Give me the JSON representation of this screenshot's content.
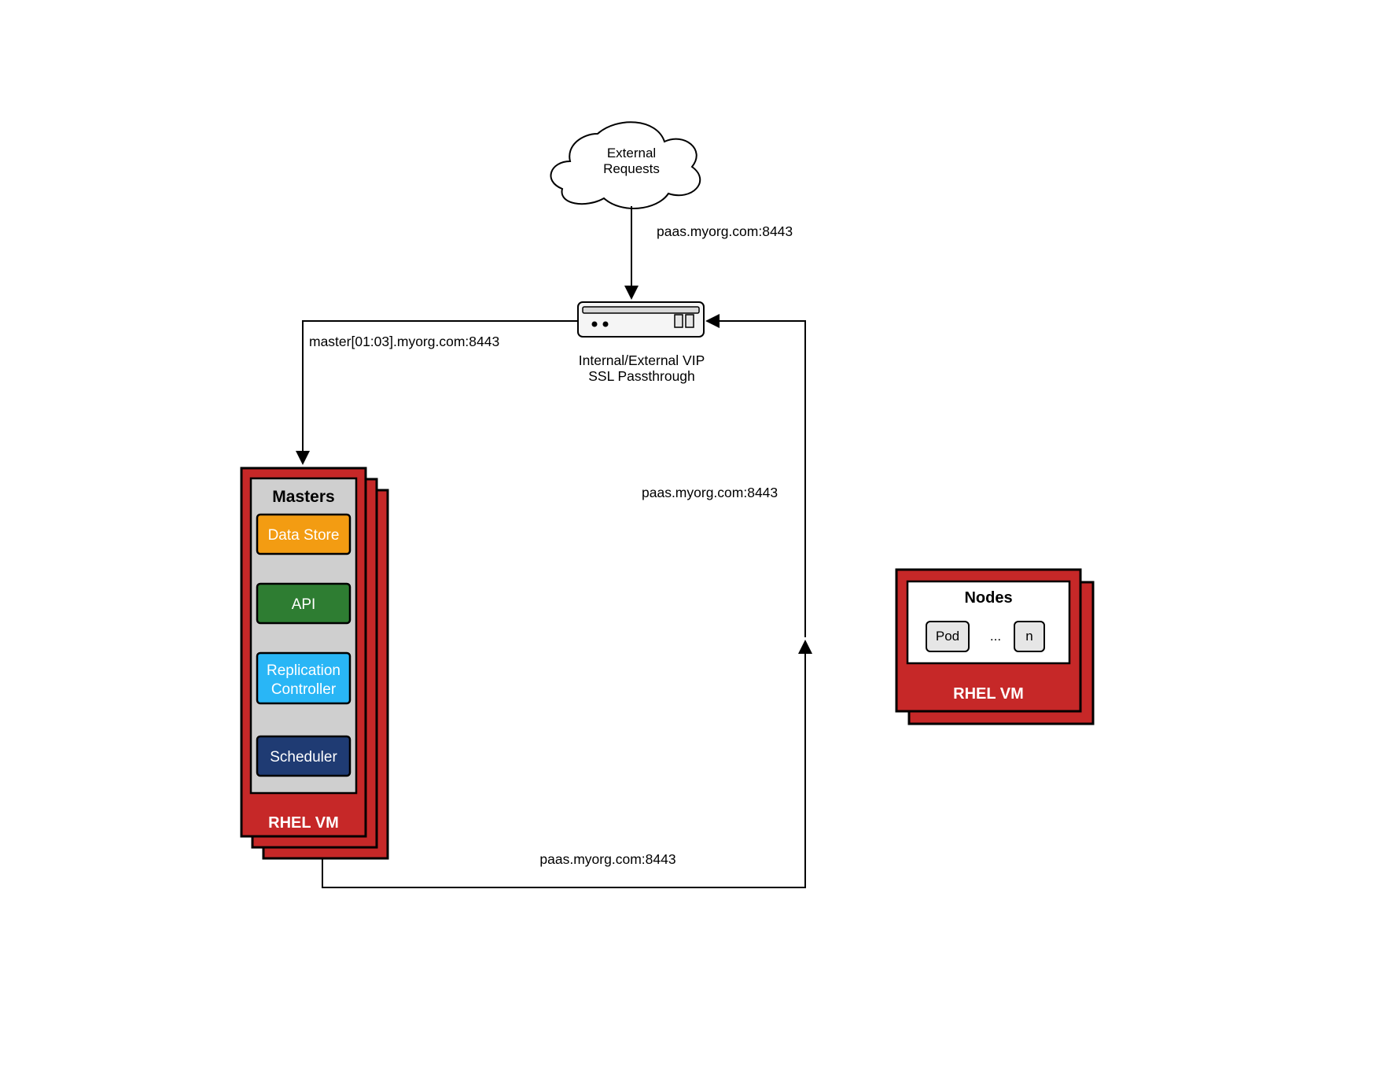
{
  "cloud": {
    "line1": "External",
    "line2": "Requests"
  },
  "labels": {
    "topArrow": "paas.myorg.com:8443",
    "leftArrow": "master[01:03].myorg.com:8443",
    "rightArrow": "paas.myorg.com:8443",
    "bottomArrow": "paas.myorg.com:8443"
  },
  "vip": {
    "line1": "Internal/External VIP",
    "line2": "SSL Passthrough"
  },
  "masters": {
    "title": "Masters",
    "dataStore": "Data Store",
    "api": "API",
    "replication1": "Replication",
    "replication2": "Controller",
    "scheduler": "Scheduler",
    "footer": "RHEL VM"
  },
  "nodes": {
    "title": "Nodes",
    "pod": "Pod",
    "dots": "...",
    "n": "n",
    "footer": "RHEL VM"
  },
  "colors": {
    "red": "#C62828",
    "grey": "#CFCFCF",
    "orange": "#F39C12",
    "green": "#2E7D32",
    "blue": "#29B6F6",
    "darkblue": "#1F3B73",
    "lightgrey": "#E6E6E6"
  }
}
